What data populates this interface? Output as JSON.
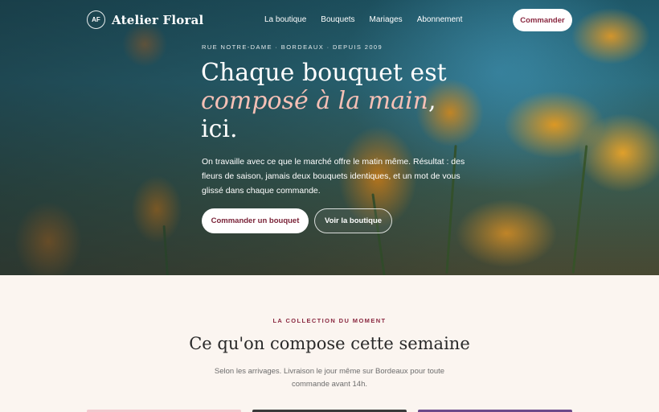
{
  "brand": {
    "mark": "AF",
    "name": "Atelier Floral"
  },
  "nav": {
    "links": [
      "La boutique",
      "Bouquets",
      "Mariages",
      "Abonnement"
    ],
    "cta": "Commander"
  },
  "hero": {
    "eyebrow": "RUE NOTRE-DAME · BORDEAUX · DEPUIS 2009",
    "headline_line1": "Chaque bouquet est",
    "headline_em": "composé à la main",
    "headline_comma": ",",
    "headline_line3": "ici.",
    "lede": "On travaille avec ce que le marché offre le matin même. Résultat : des fleurs de saison, jamais deux bouquets identiques, et un mot de vous glissé dans chaque commande.",
    "primary_cta": "Commander un bouquet",
    "secondary_cta": "Voir la boutique"
  },
  "collection": {
    "eyebrow": "LA COLLECTION DU MOMENT",
    "title": "Ce qu'on compose cette semaine",
    "subtitle": "Selon les arrivages. Livraison le jour même sur Bordeaux pour toute commande avant 14h."
  },
  "colors": {
    "accent": "#8a2840",
    "italic_accent": "#f6c0b6",
    "section_bg": "#fbf5f0",
    "card_peek": [
      "#f3c9cf",
      "#3a3a3a",
      "#6b4a8a"
    ]
  }
}
